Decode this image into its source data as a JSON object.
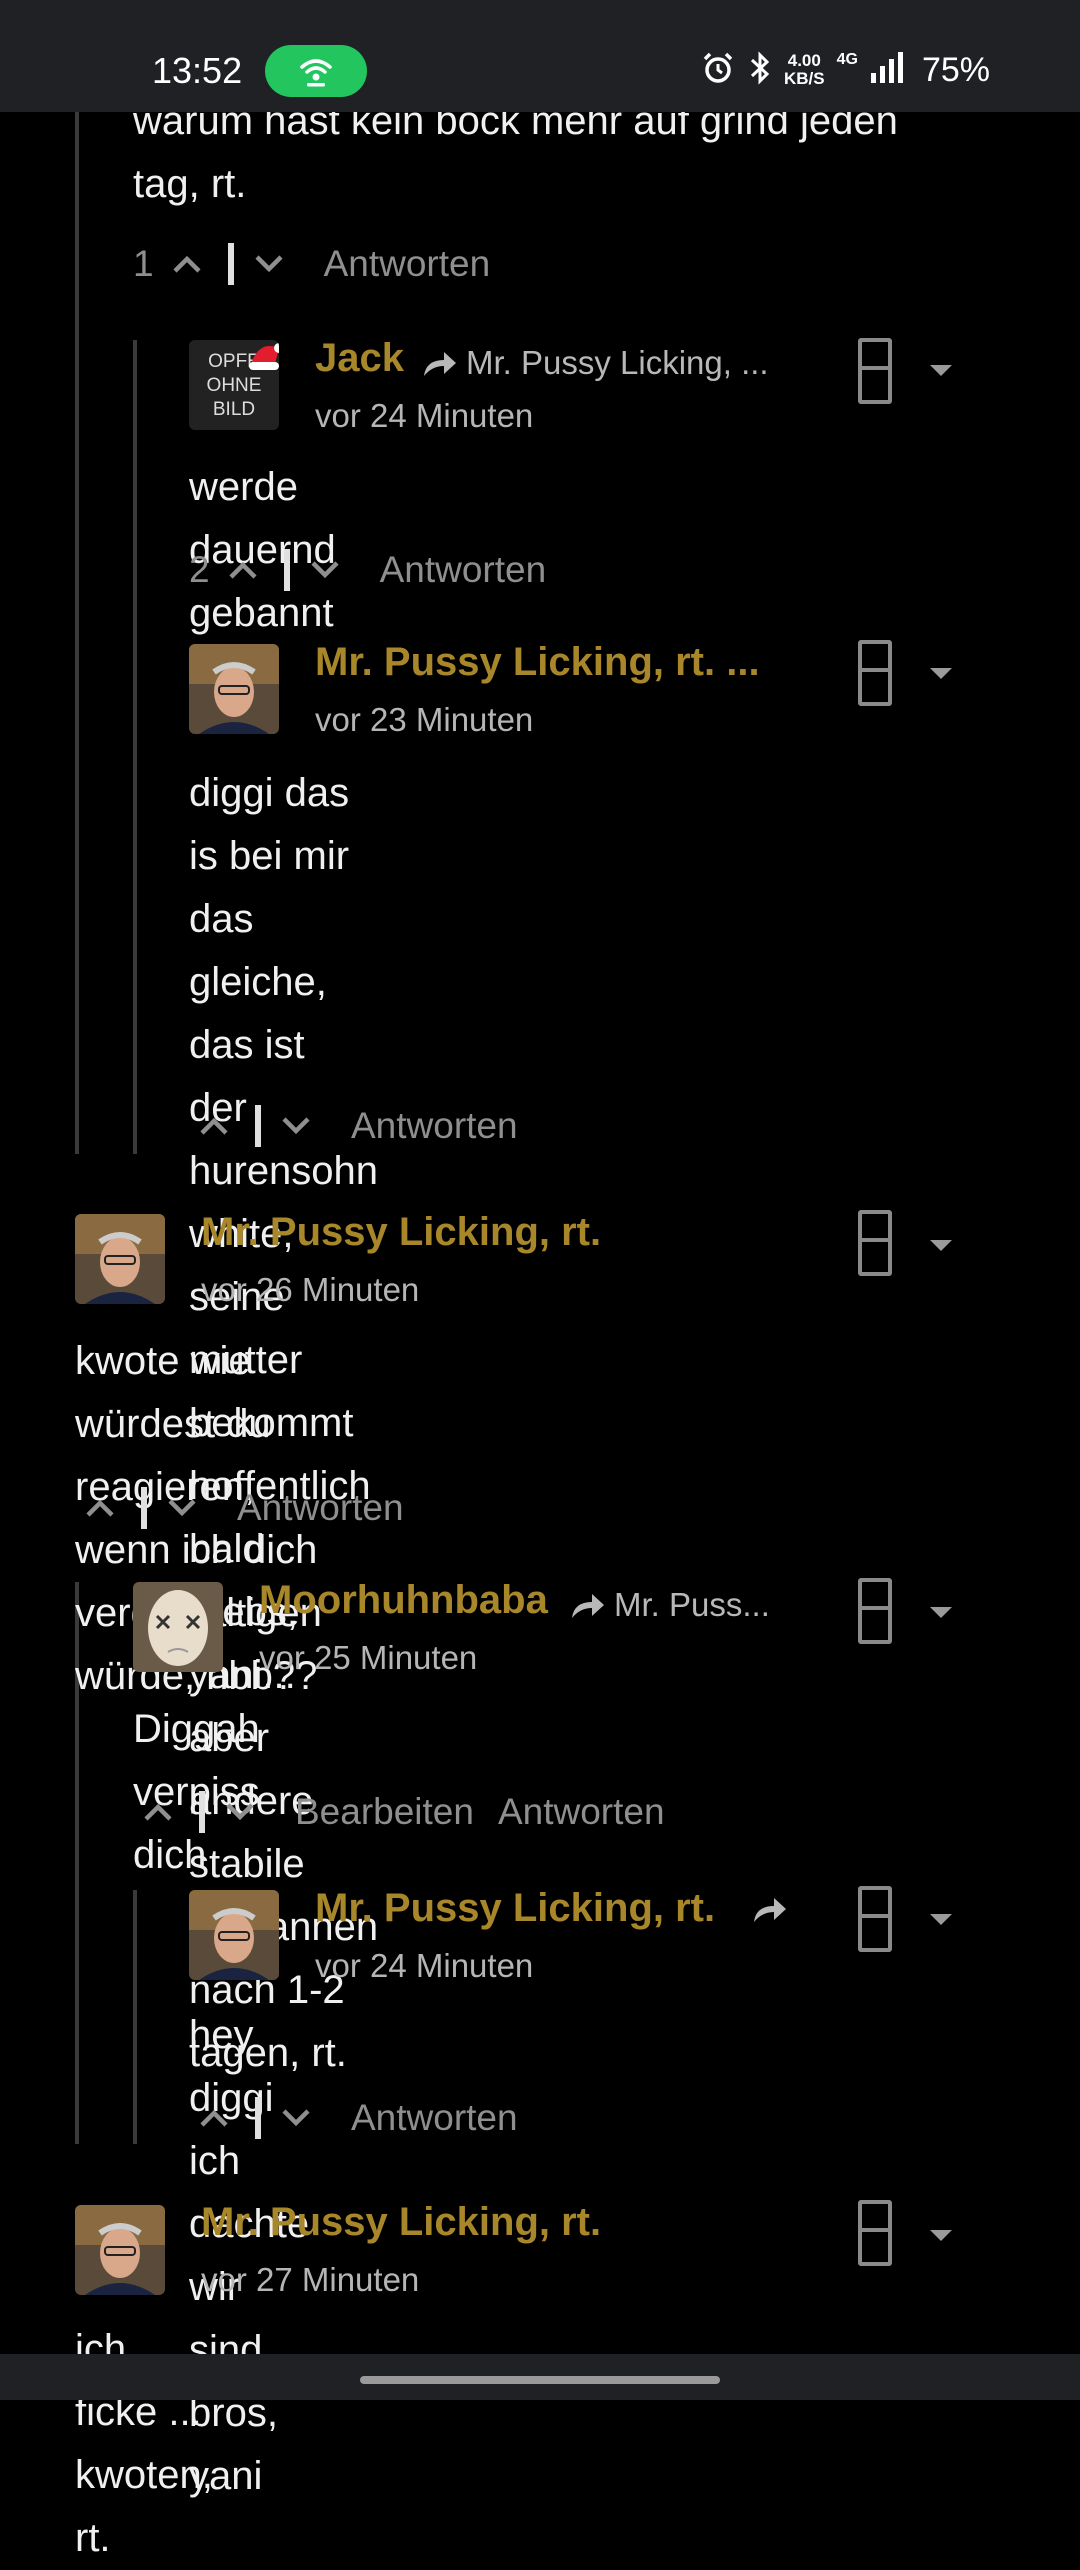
{
  "status_bar": {
    "time": "13:52",
    "speed_value": "4.00",
    "speed_unit": "KB/S",
    "network": "4G",
    "battery": "75%",
    "icons": [
      "hotspot-icon",
      "alarm-icon",
      "bluetooth-icon",
      "signal-icon"
    ]
  },
  "top_cut": {
    "text_line1": "warum hast kein bock mehr auf grind jeden",
    "text_line2": "tag, rt.",
    "count": "1",
    "reply_label": "Antworten"
  },
  "comments": [
    {
      "author": "Jack",
      "reply_to": "Mr. Pussy Licking, ...",
      "time": "vor 24 Minuten",
      "avatar_text": [
        "OPFE",
        "OHNE",
        "BILD"
      ],
      "body": "werde dauernd gebannt",
      "count": "2",
      "reply_label": "Antworten"
    },
    {
      "author": "Mr. Pussy Licking, rt. ...",
      "time": "vor 23 Minuten",
      "body_lines": [
        "diggi das is bei mir das gleiche, das ist",
        "der hurensohn white, seine mutter",
        "bekommt hoffentlich bald krebs, yani...",
        "aber andere stabile entbannen nach 1-2",
        "tagen, rt."
      ],
      "reply_label": "Antworten"
    },
    {
      "author": "Mr. Pussy Licking, rt.",
      "time": "vor 26 Minuten",
      "body_lines": [
        "kwote wie würdest du reagieren, wenn ich dich",
        "vergewaltigen würde, hbb??"
      ],
      "reply_label": "Antworten"
    },
    {
      "author": "Moorhuhnbaba",
      "reply_to": "Mr. Puss...",
      "time": "vor 25 Minuten",
      "body": "Diggah verpiss dich",
      "edit_label": "Bearbeiten",
      "reply_label": "Antworten"
    },
    {
      "author": "Mr. Pussy Licking, rt.",
      "time": "vor 24 Minuten",
      "body": "hey diggi ich dachte wir sind bros, yani",
      "reply_label": "Antworten"
    },
    {
      "author": "Mr. Pussy Licking, rt.",
      "time": "vor 27 Minuten",
      "body": "ich ficke ... kwoten, rt."
    }
  ],
  "colors": {
    "background": "#000000",
    "author": "#a8862a",
    "meta": "#b5b5b5",
    "action": "#8f8f8f",
    "hotspot": "#22c55e"
  }
}
